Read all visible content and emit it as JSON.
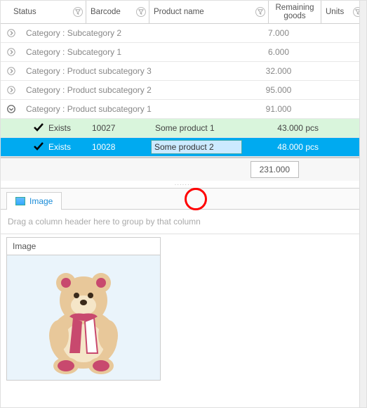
{
  "columns": {
    "status": "Status",
    "barcode": "Barcode",
    "product_name": "Product name",
    "remaining": "Remaining goods",
    "units": "Units"
  },
  "groups": [
    {
      "label": "Category : Subcategory 2",
      "value": "7.000",
      "expanded": false
    },
    {
      "label": "Category : Subcategory 1",
      "value": "6.000",
      "expanded": false
    },
    {
      "label": "Category : Product subcategory 3",
      "value": "32.000",
      "expanded": false
    },
    {
      "label": "Category : Product subcategory 2",
      "value": "95.000",
      "expanded": false
    },
    {
      "label": "Category : Product subcategory 1",
      "value": "91.000",
      "expanded": true
    }
  ],
  "rows": [
    {
      "status": "Exists",
      "barcode": "10027",
      "product": "Some product 1",
      "remaining": "43.000",
      "units": "pcs",
      "selected": false
    },
    {
      "status": "Exists",
      "barcode": "10028",
      "product": "Some product 2",
      "remaining": "48.000",
      "units": "pcs",
      "selected": true
    }
  ],
  "total": "231.000",
  "tab_label": "Image",
  "group_hint": "Drag a column header here to group by that column",
  "detail_column": "Image"
}
